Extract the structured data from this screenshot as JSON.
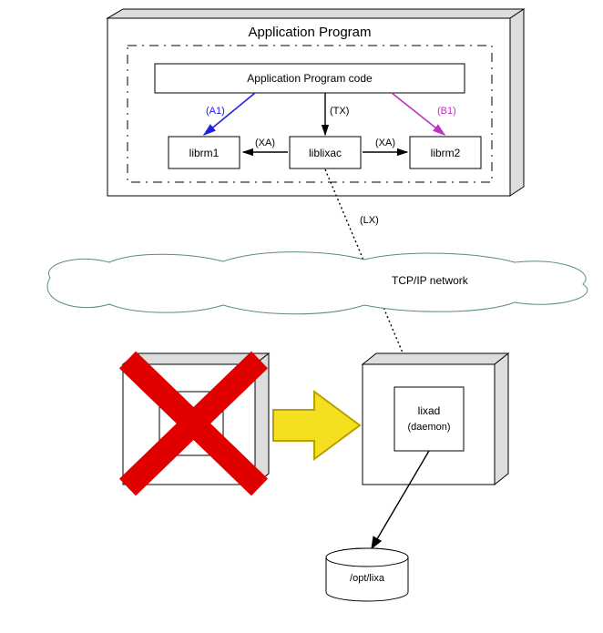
{
  "title": "Application Program",
  "inner_title": "Application Program code",
  "libs": {
    "rm1": "librm1",
    "rm2": "librm2",
    "lixac": "liblixac"
  },
  "edges": {
    "a1": "(A1)",
    "b1": "(B1)",
    "tx": "(TX)",
    "xa_left": "(XA)",
    "xa_right": "(XA)",
    "lx": "(LX)"
  },
  "net_label": "TCP/IP network",
  "daemon": {
    "line1": "lixad",
    "line2": "(daemon)"
  },
  "disk": "/opt/lixa"
}
